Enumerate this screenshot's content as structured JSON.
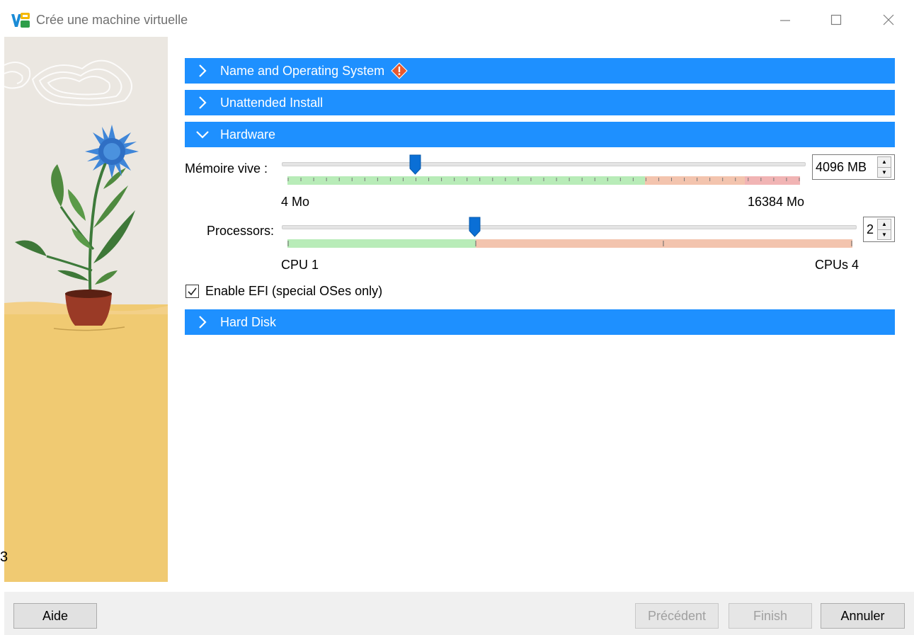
{
  "window": {
    "title": "Crée une machine virtuelle",
    "app_icon": "virtualbox-icon",
    "controls": [
      "minimize-icon",
      "maximize-icon",
      "close-icon"
    ]
  },
  "left_panel": {
    "stray_text": "3"
  },
  "sections": {
    "name_os": {
      "label": "Name and Operating System",
      "expanded": false,
      "icon": "chevron-right-icon",
      "status_icon": "warning-icon"
    },
    "unattended": {
      "label": "Unattended Install",
      "expanded": false,
      "icon": "chevron-right-icon"
    },
    "hardware": {
      "label": "Hardware",
      "expanded": true,
      "icon": "chevron-down-icon"
    },
    "hard_disk": {
      "label": "Hard Disk",
      "expanded": false,
      "icon": "chevron-right-icon"
    }
  },
  "hardware": {
    "memory": {
      "label": "Mémoire vive :",
      "value": "4096 MB",
      "min_label": "4 Mo",
      "max_label": "16384 Mo",
      "current_mb": 4096,
      "max_mb": 16384
    },
    "processors": {
      "label": "Processors:",
      "value": "2",
      "min_label": "CPU 1",
      "max_label": "CPUs 4",
      "current": 2,
      "max": 4
    },
    "efi": {
      "label": "Enable EFI (special OSes only)",
      "checked": true
    }
  },
  "buttons": {
    "help": "Aide",
    "previous": "Précédent",
    "finish": "Finish",
    "cancel": "Annuler"
  },
  "colors": {
    "section_header": "#1e90ff",
    "scale_green": "#b8ecb8",
    "scale_orange": "#f3c4ae",
    "scale_red": "#f1b4b4",
    "slider_thumb": "#0a6fd6",
    "warning": "#e8582c"
  }
}
